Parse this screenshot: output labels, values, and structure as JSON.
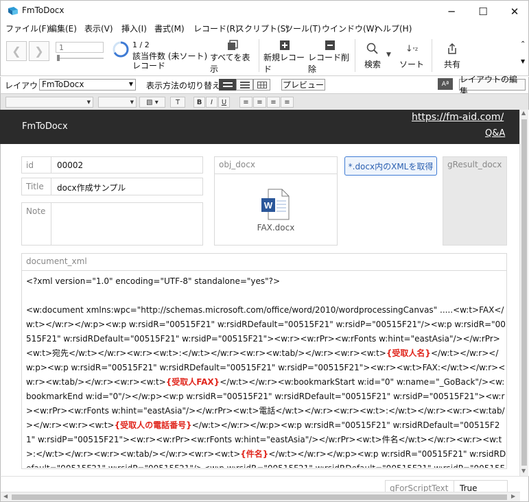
{
  "window": {
    "title": "FmToDocx",
    "minimize": "─",
    "maximize": "☐",
    "close": "✕"
  },
  "menu": [
    "ファイル(F)",
    "編集(E)",
    "表示(V)",
    "挿入(I)",
    "書式(M)",
    "レコード(R)",
    "スクリプト(S)",
    "ツール(T)",
    "ウインドウ(W)",
    "ヘルプ(H)"
  ],
  "toolbar": {
    "record_input": "1",
    "record_count": "1 / 2",
    "found_status": "該当件数 (未ソート)",
    "records_label": "レコード",
    "show_all": "すべてを表示",
    "new_record": "新規レコード",
    "delete_record": "レコード削除",
    "search": "検索",
    "sort": "ソート",
    "share": "共有"
  },
  "layoutbar": {
    "layout_label": "レイアウト:",
    "layout_value": "FmToDocx",
    "view_switch_label": "表示方法の切り替え:",
    "preview": "プレビュー",
    "aa": "Aª",
    "edit_layout": "レイアウトの編集"
  },
  "header": {
    "title": "FmToDocx",
    "url": "https://fm-aid.com/",
    "qa": "Q&A"
  },
  "fields": {
    "id_label": "id",
    "id_value": "00002",
    "title_label": "Title",
    "title_value": "docx作成サンプル",
    "note_label": "Note",
    "obj_label": "obj_docx",
    "obj_file": "FAX.docx",
    "get_xml_button": "*.docx内のXMLを取得",
    "gresult_label": "gResult_docx",
    "doc_xml_label": "document_xml"
  },
  "document_xml": [
    {
      "t": "<?xml version=\"1.0\" encoding=\"UTF-8\" standalone=\"yes\"?>\n\n<w:document xmlns:wpc=\"http://schemas.microsoft.com/office/word/2010/wordprocessingCanvas\" .....<w:t>FAX</w:t></w:r></w:p><w:p w:rsidR=\"00515F21\" w:rsidRDefault=\"00515F21\" w:rsidP=\"00515F21\"/><w:p w:rsidR=\"00515F21\" w:rsidRDefault=\"00515F21\" w:rsidP=\"00515F21\"><w:r><w:rPr><w:rFonts w:hint=\"eastAsia\"/></w:rPr><w:t>宛先</w:t></w:r><w:r><w:t>:</w:t></w:r><w:r><w:tab/></w:r><w:r><w:t>",
      "r": false
    },
    {
      "t": "{受取人名}",
      "r": true
    },
    {
      "t": "</w:t></w:r></w:p><w:p w:rsidR=\"00515F21\" w:rsidRDefault=\"00515F21\" w:rsidP=\"00515F21\"><w:r><w:t>FAX:</w:t></w:r><w:r><w:tab/></w:r><w:r><w:t>",
      "r": false
    },
    {
      "t": "{受取人FAX}",
      "r": true
    },
    {
      "t": "</w:t></w:r><w:bookmarkStart w:id=\"0\" w:name=\"_GoBack\"/><w:bookmarkEnd w:id=\"0\"/></w:p><w:p w:rsidR=\"00515F21\" w:rsidRDefault=\"00515F21\" w:rsidP=\"00515F21\"><w:r><w:rPr><w:rFonts w:hint=\"eastAsia\"/></w:rPr><w:t>電話</w:t></w:r><w:r><w:t>:</w:t></w:r><w:r><w:tab/></w:r><w:r><w:t>",
      "r": false
    },
    {
      "t": "{受取人の電話番号}",
      "r": true
    },
    {
      "t": "</w:t></w:r></w:p><w:p w:rsidR=\"00515F21\" w:rsidRDefault=\"00515F21\" w:rsidP=\"00515F21\"><w:r><w:rPr><w:rFonts w:hint=\"eastAsia\"/></w:rPr><w:t>件名</w:t></w:r><w:r><w:t>:</w:t></w:r><w:r><w:tab/></w:r><w:r><w:t>",
      "r": false
    },
    {
      "t": "{件名}",
      "r": true
    },
    {
      "t": "</w:t></w:r></w:p><w:p w:rsidR=\"00515F21\" w:rsidRDefault=\"00515F21\" w:rsidP=\"00515F21\"/><w:p w:rsidR=\"00515F21\" w:rsidRDefault=\"00515F21\" w:rsidP=\"00515F21\"><w:r><w:rPr><w:rFonts w:hint=\"eastAsia\"/></w:rPr><w:t>差出人",
      "r": false
    }
  ],
  "footer": {
    "script_label": "gForScriptText",
    "script_value": "True"
  },
  "colors": {
    "header_bg": "#2b2b2b",
    "accent_blue": "#3f7bd4",
    "highlight_red": "#e0261d"
  }
}
